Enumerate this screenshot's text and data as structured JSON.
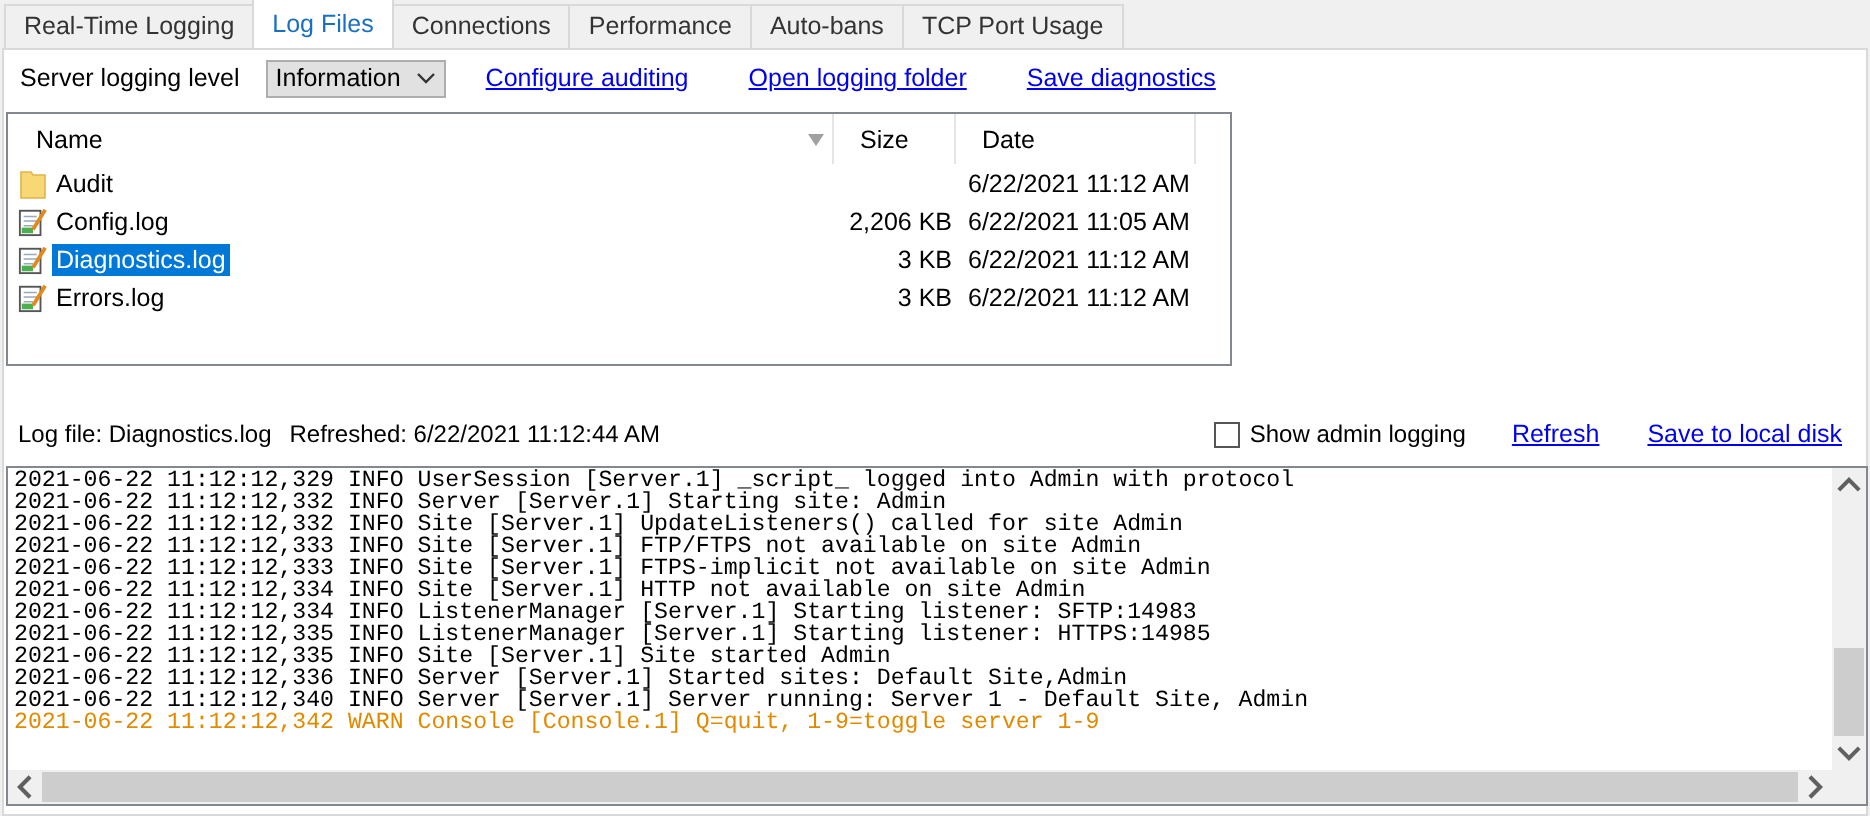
{
  "tabs": [
    {
      "label": "Real-Time Logging",
      "selected": false
    },
    {
      "label": "Log Files",
      "selected": true
    },
    {
      "label": "Connections",
      "selected": false
    },
    {
      "label": "Performance",
      "selected": false
    },
    {
      "label": "Auto-bans",
      "selected": false
    },
    {
      "label": "TCP Port Usage",
      "selected": false
    }
  ],
  "toolbar": {
    "level_label": "Server logging level",
    "level_value": "Information",
    "links": [
      "Configure auditing",
      "Open logging folder",
      "Save diagnostics"
    ]
  },
  "file_list": {
    "columns": [
      "Name",
      "Size",
      "Date"
    ],
    "rows": [
      {
        "kind": "folder",
        "name": "Audit",
        "size": "",
        "date": "6/22/2021 11:12 AM",
        "selected": false
      },
      {
        "kind": "file",
        "name": "Config.log",
        "size": "2,206 KB",
        "date": "6/22/2021 11:05 AM",
        "selected": false
      },
      {
        "kind": "file",
        "name": "Diagnostics.log",
        "size": "3 KB",
        "date": "6/22/2021 11:12 AM",
        "selected": true
      },
      {
        "kind": "file",
        "name": "Errors.log",
        "size": "3 KB",
        "date": "6/22/2021 11:12 AM",
        "selected": false
      }
    ]
  },
  "status": {
    "log_file": "Log file: Diagnostics.log",
    "refreshed": "Refreshed: 6/22/2021 11:12:44 AM",
    "show_admin_logging": {
      "label": "Show admin logging",
      "checked": false
    },
    "links": [
      "Refresh",
      "Save to local disk"
    ]
  },
  "log": [
    {
      "kind": "info",
      "text": "2021-06-22 11:12:12,329 INFO UserSession [Server.1] _script_ logged into Admin with protocol"
    },
    {
      "kind": "info",
      "text": "2021-06-22 11:12:12,332 INFO Server [Server.1] Starting site: Admin"
    },
    {
      "kind": "info",
      "text": "2021-06-22 11:12:12,332 INFO Site [Server.1] UpdateListeners() called for site Admin"
    },
    {
      "kind": "info",
      "text": "2021-06-22 11:12:12,333 INFO Site [Server.1] FTP/FTPS not available on site Admin"
    },
    {
      "kind": "info",
      "text": "2021-06-22 11:12:12,333 INFO Site [Server.1] FTPS-implicit not available on site Admin"
    },
    {
      "kind": "info",
      "text": "2021-06-22 11:12:12,334 INFO Site [Server.1] HTTP not available on site Admin"
    },
    {
      "kind": "info",
      "text": "2021-06-22 11:12:12,334 INFO ListenerManager [Server.1] Starting listener: SFTP:14983"
    },
    {
      "kind": "info",
      "text": "2021-06-22 11:12:12,335 INFO ListenerManager [Server.1] Starting listener: HTTPS:14985"
    },
    {
      "kind": "info",
      "text": "2021-06-22 11:12:12,335 INFO Site [Server.1] Site started Admin"
    },
    {
      "kind": "info",
      "text": "2021-06-22 11:12:12,336 INFO Server [Server.1] Started sites: Default Site,Admin"
    },
    {
      "kind": "info",
      "text": "2021-06-22 11:12:12,340 INFO Server [Server.1] Server running: Server 1 - Default Site, Admin"
    },
    {
      "kind": "warn",
      "text": "2021-06-22 11:12:12,342 WARN Console [Console.1] Q=quit, 1-9=toggle server 1-9"
    }
  ]
}
